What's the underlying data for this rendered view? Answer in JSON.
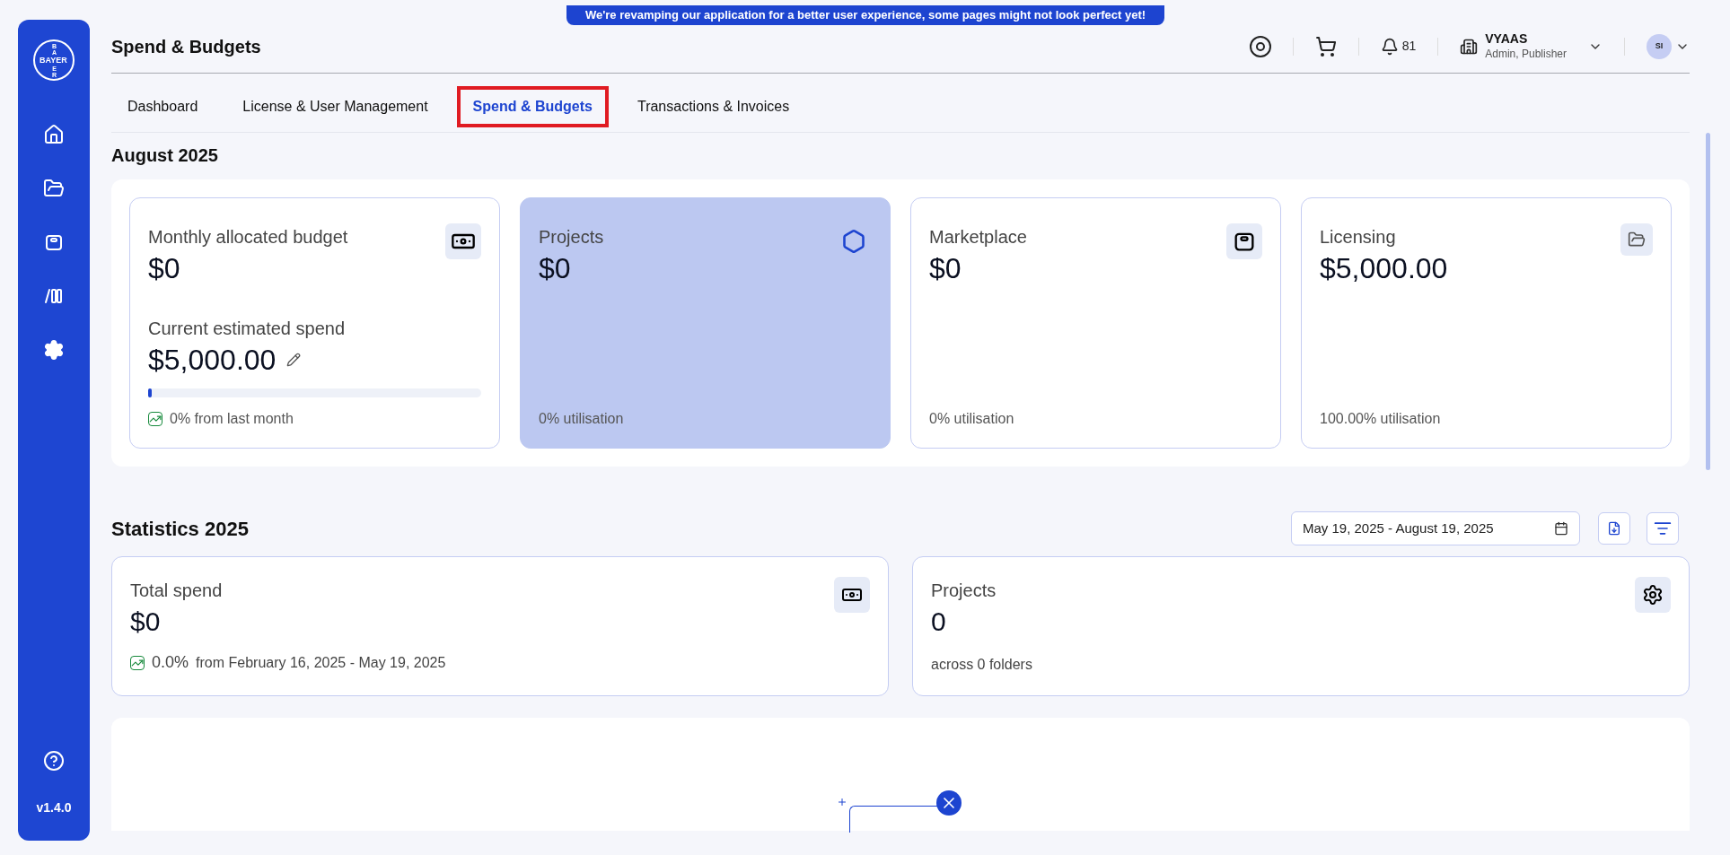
{
  "banner": "We're revamping our application for a better user experience, some pages might not look perfect yet!",
  "sidebar": {
    "logo": {
      "horizontal": "BAYER",
      "top": "BA",
      "bottom": "ER"
    },
    "version": "v1.4.0"
  },
  "header": {
    "title": "Spend & Budgets",
    "notification_count": "81",
    "org_name": "VYAAS",
    "org_roles": "Admin, Publisher",
    "avatar_initials": "SI"
  },
  "tabs": [
    {
      "label": "Dashboard",
      "selected": false
    },
    {
      "label": "License & User Management",
      "selected": false
    },
    {
      "label": "Spend & Budgets",
      "selected": true
    },
    {
      "label": "Transactions & Invoices",
      "selected": false
    }
  ],
  "monthly": {
    "heading": "August 2025",
    "cards": [
      {
        "kind": "budget",
        "selected": false,
        "label": "Monthly allocated budget",
        "value": "$0",
        "spend_label": "Current estimated spend",
        "spend_value": "$5,000.00",
        "level": 0,
        "trend": "0% from last month"
      },
      {
        "kind": "category",
        "selected": true,
        "label": "Projects",
        "value": "$0",
        "footnote": "0% utilisation"
      },
      {
        "kind": "category",
        "selected": false,
        "label": "Marketplace",
        "value": "$0",
        "footnote": "0% utilisation"
      },
      {
        "kind": "category",
        "selected": false,
        "label": "Licensing",
        "value": "$5,000.00",
        "footnote": "100.00% utilisation"
      }
    ]
  },
  "statistics": {
    "heading": "Statistics 2025",
    "date_range": "May 19, 2025 - August 19, 2025",
    "cards": [
      {
        "kind": "change",
        "label": "Total spend",
        "value": "$0",
        "change": "0.0%",
        "period": "from February 16, 2025 - May 19, 2025"
      },
      {
        "kind": "note",
        "label": "Projects",
        "value": "0",
        "note": "across 0 folders"
      }
    ]
  }
}
